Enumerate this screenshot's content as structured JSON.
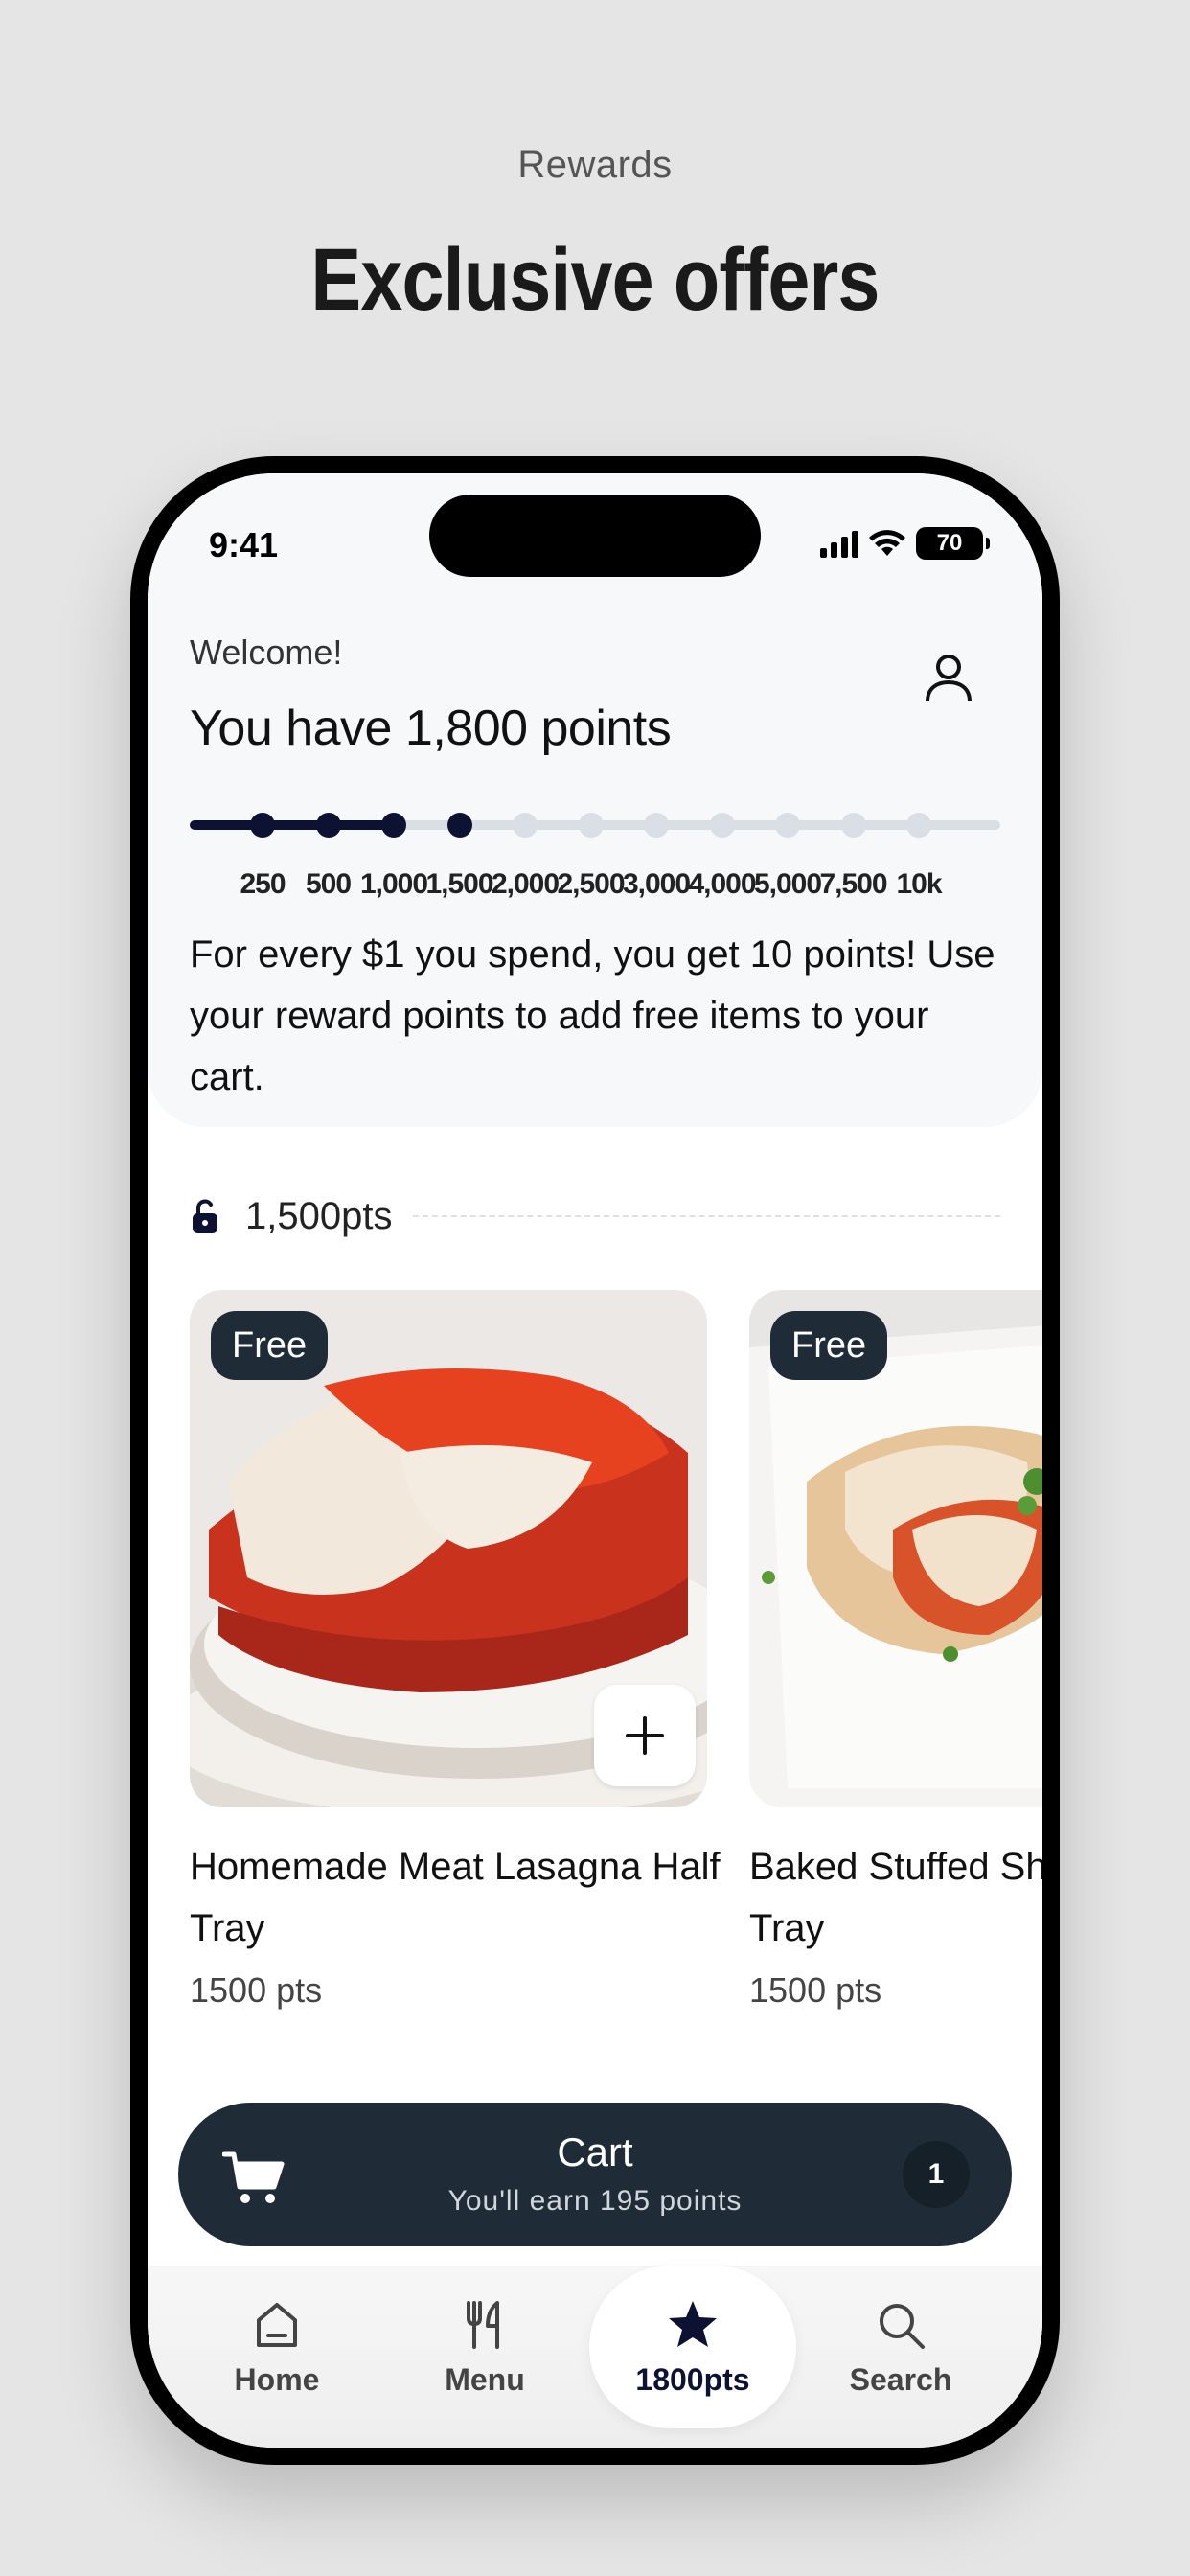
{
  "page": {
    "eyebrow": "Rewards",
    "headline": "Exclusive offers"
  },
  "status_bar": {
    "time": "9:41",
    "battery": "70"
  },
  "header": {
    "welcome": "Welcome!",
    "points_heading": "You have 1,800 points",
    "intro_text": "For every $1 you spend, you get 10 points! Use your reward points to add free items to your cart."
  },
  "progress": {
    "current_points": 1800,
    "ticks": [
      "250",
      "500",
      "1,000",
      "1,500",
      "2,000",
      "2,500",
      "3,000",
      "4,000",
      "5,000",
      "7,500",
      "10k"
    ],
    "reached_count": 4
  },
  "tier": {
    "label": "1,500pts"
  },
  "products": [
    {
      "badge": "Free",
      "name": "Homemade Meat Lasagna Half Tray",
      "points": "1500 pts"
    },
    {
      "badge": "Free",
      "name": "Baked Stuffed Shells Half Tray",
      "points": "1500 pts"
    }
  ],
  "cart": {
    "title": "Cart",
    "subtitle": "You'll earn 195 points",
    "count": "1"
  },
  "tabs": [
    {
      "label": "Home",
      "icon": "home-icon"
    },
    {
      "label": "Menu",
      "icon": "utensils-icon"
    },
    {
      "label": "1800pts",
      "icon": "star-icon",
      "active": true
    },
    {
      "label": "Search",
      "icon": "search-icon"
    }
  ],
  "colors": {
    "background": "#e5e5e5",
    "accent_navy": "#0d1233",
    "dark_slate": "#1f2c38",
    "track_gray": "#d9dfe4"
  }
}
